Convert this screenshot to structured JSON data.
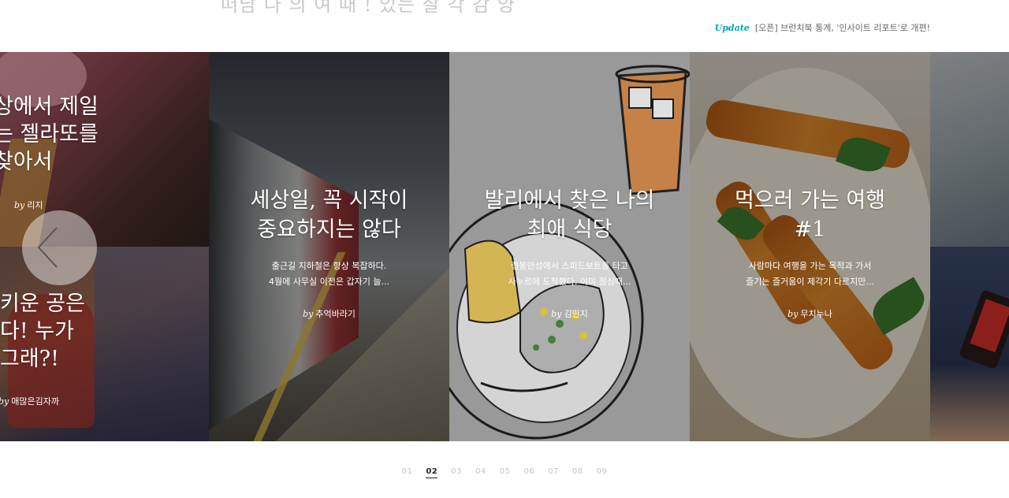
{
  "header": {
    "faded_heading": "떠남 나 의 여 때 ! 있는 잘 각 감 양",
    "update_label": "Update",
    "update_text": "[오픈] 브런치북 통계, '인사이트 리포트'로 개편!"
  },
  "carousel": {
    "left_cards": [
      {
        "title_lines": [
          "상에서 제일",
          "는 젤라또를",
          "찾아서"
        ],
        "by_prefix": "by",
        "author": "리지"
      },
      {
        "title_lines": [
          "키운 공은",
          "다! 누가",
          "그래?!"
        ],
        "by_prefix": "by",
        "author": "애많은김자까"
      }
    ],
    "cards": [
      {
        "title_lines": [
          "세상일, 꼭 시작이",
          "중요하지는 않다"
        ],
        "desc_lines": [
          "출근길 지하철은 항상 복잡하다.",
          "4월에 사무실 이전은 갑자기 늘..."
        ],
        "by_prefix": "by",
        "author": "추억바라기"
      },
      {
        "title_lines": [
          "발리에서 찾은 나의",
          "최애 식당"
        ],
        "desc_lines": [
          "렘봉안섬에서 스피드보트를 타고",
          "사누르에 도착했다. 이미 점심때..."
        ],
        "by_prefix": "by",
        "author": "김민지"
      },
      {
        "title_lines": [
          "먹으러 가는 여행",
          "#1"
        ],
        "desc_lines": [
          "사람마다 여행을 가는 목적과 가서",
          "즐기는 즐거움이 제각기 다르지만..."
        ],
        "by_prefix": "by",
        "author": "무치누나"
      }
    ],
    "prev_icon": "chevron-left-icon"
  },
  "pagination": {
    "pages": [
      "01",
      "02",
      "03",
      "04",
      "05",
      "06",
      "07",
      "08",
      "09"
    ],
    "active": "02"
  }
}
